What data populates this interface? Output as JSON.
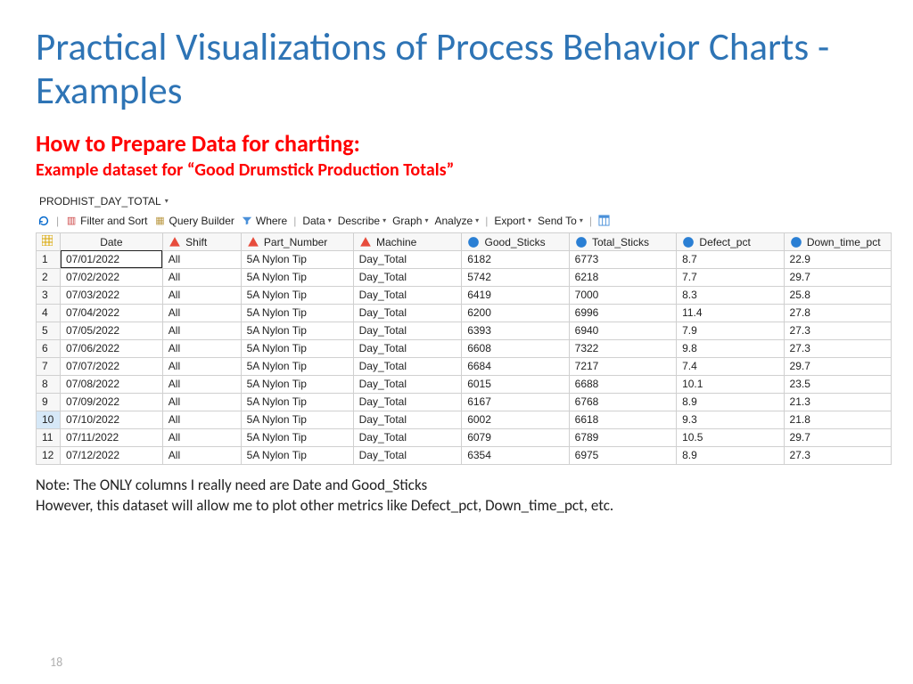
{
  "title": "Practical Visualizations of Process Behavior Charts - Examples",
  "subtitle1": "How to Prepare Data for charting:",
  "subtitle2": "Example dataset for “Good Drumstick Production Totals”",
  "dataset_name": "PRODHIST_DAY_TOTAL",
  "toolbar": {
    "filter_sort": "Filter and Sort",
    "query_builder": "Query Builder",
    "where": "Where",
    "data": "Data",
    "describe": "Describe",
    "graph": "Graph",
    "analyze": "Analyze",
    "export": "Export",
    "send_to": "Send To"
  },
  "columns": [
    "Date",
    "Shift",
    "Part_Number",
    "Machine",
    "Good_Sticks",
    "Total_Sticks",
    "Defect_pct",
    "Down_time_pct"
  ],
  "rows": [
    {
      "n": "1",
      "date": "07/01/2022",
      "shift": "All",
      "part": "5A Nylon Tip",
      "machine": "Day_Total",
      "good": "6182",
      "total": "6773",
      "defect": "8.7",
      "down": "22.9"
    },
    {
      "n": "2",
      "date": "07/02/2022",
      "shift": "All",
      "part": "5A Nylon Tip",
      "machine": "Day_Total",
      "good": "5742",
      "total": "6218",
      "defect": "7.7",
      "down": "29.7"
    },
    {
      "n": "3",
      "date": "07/03/2022",
      "shift": "All",
      "part": "5A Nylon Tip",
      "machine": "Day_Total",
      "good": "6419",
      "total": "7000",
      "defect": "8.3",
      "down": "25.8"
    },
    {
      "n": "4",
      "date": "07/04/2022",
      "shift": "All",
      "part": "5A Nylon Tip",
      "machine": "Day_Total",
      "good": "6200",
      "total": "6996",
      "defect": "11.4",
      "down": "27.8"
    },
    {
      "n": "5",
      "date": "07/05/2022",
      "shift": "All",
      "part": "5A Nylon Tip",
      "machine": "Day_Total",
      "good": "6393",
      "total": "6940",
      "defect": "7.9",
      "down": "27.3"
    },
    {
      "n": "6",
      "date": "07/06/2022",
      "shift": "All",
      "part": "5A Nylon Tip",
      "machine": "Day_Total",
      "good": "6608",
      "total": "7322",
      "defect": "9.8",
      "down": "27.3"
    },
    {
      "n": "7",
      "date": "07/07/2022",
      "shift": "All",
      "part": "5A Nylon Tip",
      "machine": "Day_Total",
      "good": "6684",
      "total": "7217",
      "defect": "7.4",
      "down": "29.7"
    },
    {
      "n": "8",
      "date": "07/08/2022",
      "shift": "All",
      "part": "5A Nylon Tip",
      "machine": "Day_Total",
      "good": "6015",
      "total": "6688",
      "defect": "10.1",
      "down": "23.5"
    },
    {
      "n": "9",
      "date": "07/09/2022",
      "shift": "All",
      "part": "5A Nylon Tip",
      "machine": "Day_Total",
      "good": "6167",
      "total": "6768",
      "defect": "8.9",
      "down": "21.3"
    },
    {
      "n": "10",
      "date": "07/10/2022",
      "shift": "All",
      "part": "5A Nylon Tip",
      "machine": "Day_Total",
      "good": "6002",
      "total": "6618",
      "defect": "9.3",
      "down": "21.8"
    },
    {
      "n": "11",
      "date": "07/11/2022",
      "shift": "All",
      "part": "5A Nylon Tip",
      "machine": "Day_Total",
      "good": "6079",
      "total": "6789",
      "defect": "10.5",
      "down": "29.7"
    },
    {
      "n": "12",
      "date": "07/12/2022",
      "shift": "All",
      "part": "5A Nylon Tip",
      "machine": "Day_Total",
      "good": "6354",
      "total": "6975",
      "defect": "8.9",
      "down": "27.3"
    }
  ],
  "note1": "Note: The ONLY columns I really need are Date and Good_Sticks",
  "note2": "However, this dataset will allow me to plot other metrics like Defect_pct, Down_time_pct, etc.",
  "page_number": "18"
}
